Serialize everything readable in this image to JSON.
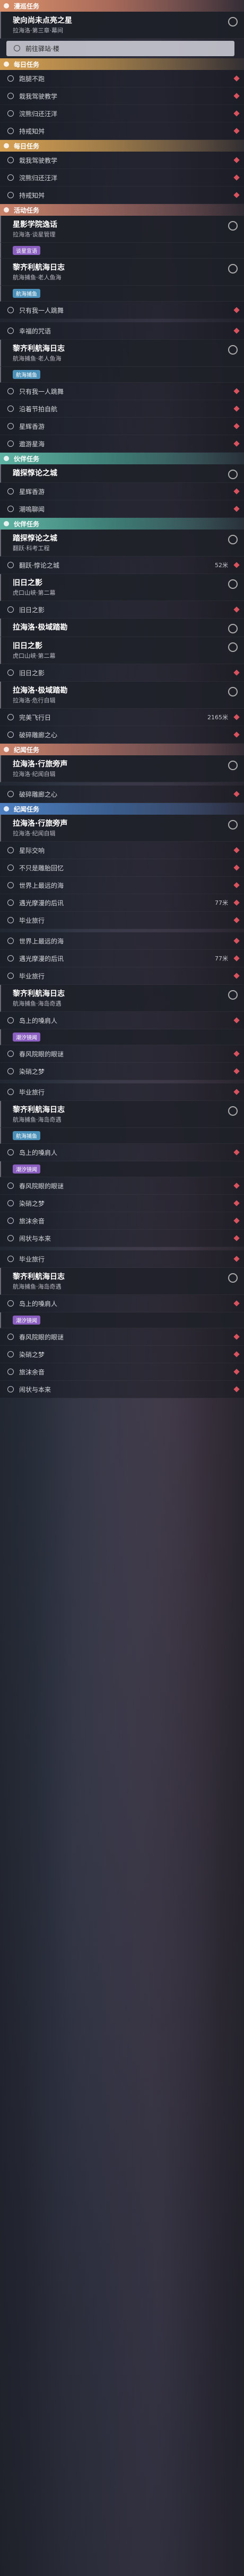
{
  "blocks": [
    {
      "k": "h",
      "c": "main",
      "text": "漫巡任务"
    },
    {
      "k": "c",
      "title": "驶向尚未点亮之星",
      "sub": "拉海洛·第三章·幕间"
    },
    {
      "k": "r",
      "text": "前往驿站·楼",
      "sel": true
    },
    {
      "k": "h",
      "c": "daily",
      "text": "每日任务"
    },
    {
      "k": "r",
      "text": "跑腿不跑"
    },
    {
      "k": "r",
      "text": "栽我驾驶教学"
    },
    {
      "k": "r",
      "text": "浣熊归还汪洋"
    },
    {
      "k": "r",
      "text": "持戒知舛"
    },
    {
      "k": "h",
      "c": "daily",
      "text": "每日任务"
    },
    {
      "k": "r",
      "text": "栽我驾驶教学"
    },
    {
      "k": "r",
      "text": "浣熊归还汪洋"
    },
    {
      "k": "r",
      "text": "持戒知舛"
    },
    {
      "k": "h",
      "c": "event",
      "text": "活动任务"
    },
    {
      "k": "c",
      "title": "星影学院逸话",
      "sub": "拉海洛·谈星管理"
    },
    {
      "k": "tg",
      "text": "谈星宣语",
      "c": "purple"
    },
    {
      "k": "c",
      "title": "黎齐利航海日志",
      "sub": "航海捕鱼·老人鱼海"
    },
    {
      "k": "tg",
      "text": "航海捕鱼",
      "c": "blue"
    },
    {
      "k": "r",
      "text": "只有我一人跳舞"
    },
    {
      "k": "gap"
    },
    {
      "k": "r",
      "text": "幸福的咒语"
    },
    {
      "k": "c",
      "title": "黎齐利航海日志",
      "sub": "航海捕鱼·老人鱼海"
    },
    {
      "k": "tg",
      "text": "航海捕鱼",
      "c": "blue"
    },
    {
      "k": "r",
      "text": "只有我一人跳舞"
    },
    {
      "k": "r",
      "text": "沿着节拍自航"
    },
    {
      "k": "r",
      "text": "星辉香游"
    },
    {
      "k": "r",
      "text": "遨游星海"
    },
    {
      "k": "h",
      "c": "friend",
      "text": "伙伴任务"
    },
    {
      "k": "c",
      "title": "踏探惇论之城",
      "sub": ""
    },
    {
      "k": "r",
      "text": "星辉香游"
    },
    {
      "k": "r",
      "text": "潮嗚聊闻"
    },
    {
      "k": "h",
      "c": "friend",
      "text": "伙伴任务"
    },
    {
      "k": "c",
      "title": "踏探惇论之城",
      "sub": "翻跃·科考工程"
    },
    {
      "k": "r",
      "text": "翻跃·惇论之城",
      "right": "52米"
    },
    {
      "k": "c",
      "title": "旧日之影",
      "sub": "虎口山峡·第二幕"
    },
    {
      "k": "r",
      "text": "旧日之影"
    },
    {
      "k": "c",
      "title": "拉海洛·极域踏勘",
      "sub": ""
    },
    {
      "k": "c",
      "title": "旧日之影",
      "sub": "虎口山峡·第二幕"
    },
    {
      "k": "r",
      "text": "旧日之影"
    },
    {
      "k": "c",
      "title": "拉海洛·极域踏勘",
      "sub": "拉海洛·危行自辑"
    },
    {
      "k": "r",
      "text": "完美飞行日",
      "right": "2165米"
    },
    {
      "k": "r",
      "text": "破碎雕廊之心"
    },
    {
      "k": "h",
      "c": "event",
      "text": "纪闻任务"
    },
    {
      "k": "c",
      "title": "拉海洛·行旅旁声",
      "sub": "拉海洛·纪闻自辑"
    },
    {
      "k": "gap"
    },
    {
      "k": "r",
      "text": "破碎雕廊之心"
    },
    {
      "k": "h",
      "c": "ji",
      "text": "纪闻任务"
    },
    {
      "k": "c",
      "title": "拉海洛·行旅旁声",
      "sub": "拉海洛·纪闻自辑"
    },
    {
      "k": "r",
      "text": "星际交响"
    },
    {
      "k": "r",
      "text": "不只是雕胎回忆"
    },
    {
      "k": "r",
      "text": "世界上最远的海"
    },
    {
      "k": "r",
      "text": "遇光摩漫的后讯",
      "right": "77米"
    },
    {
      "k": "r",
      "text": "毕业旅行"
    },
    {
      "k": "gap"
    },
    {
      "k": "r",
      "text": "世界上最远的海"
    },
    {
      "k": "r",
      "text": "遇光摩漫的后讯",
      "right": "77米"
    },
    {
      "k": "r",
      "text": "毕业旅行"
    },
    {
      "k": "c",
      "title": "黎齐利航海日志",
      "sub": "航海捕鱼·海岛奇遇"
    },
    {
      "k": "r",
      "text": "岛上的嗓肩人"
    },
    {
      "k": "tg",
      "text": "潮汐镜闻",
      "c": "purple"
    },
    {
      "k": "r",
      "text": "春风院眼的眼谜"
    },
    {
      "k": "r",
      "text": "染硝之梦"
    },
    {
      "k": "gap"
    },
    {
      "k": "r",
      "text": "毕业旅行"
    },
    {
      "k": "c",
      "title": "黎齐利航海日志",
      "sub": "航海捕鱼·海岛奇遇"
    },
    {
      "k": "tg",
      "text": "航海捕鱼",
      "c": "blue"
    },
    {
      "k": "r",
      "text": "岛上的嗓肩人"
    },
    {
      "k": "tg",
      "text": "潮汐镜闻",
      "c": "purple"
    },
    {
      "k": "r",
      "text": "春风院眼的眼谜"
    },
    {
      "k": "r",
      "text": "染硝之梦"
    },
    {
      "k": "r",
      "text": "旅沫余音"
    },
    {
      "k": "r",
      "text": "闹状与本来"
    },
    {
      "k": "gap"
    },
    {
      "k": "r",
      "text": "毕业旅行"
    },
    {
      "k": "c",
      "title": "黎齐利航海日志",
      "sub": "航海捕鱼·海岛奇遇"
    },
    {
      "k": "r",
      "text": "岛上的嗓肩人"
    },
    {
      "k": "tg",
      "text": "潮汐镜闻",
      "c": "purple"
    },
    {
      "k": "r",
      "text": "春风院眼的眼谜"
    },
    {
      "k": "r",
      "text": "染硝之梦"
    },
    {
      "k": "r",
      "text": "旅沫余音"
    },
    {
      "k": "r",
      "text": "闹状与本来"
    }
  ]
}
